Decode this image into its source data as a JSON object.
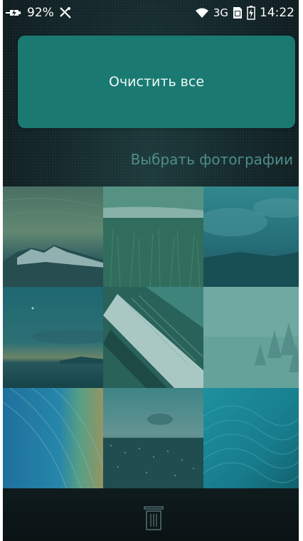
{
  "status_bar": {
    "battery_percent": "92%",
    "network": "3G",
    "time": "14:22",
    "icons": [
      "charging-icon",
      "no-signal-tools-icon",
      "wifi-icon",
      "sim-icon",
      "battery-icon"
    ]
  },
  "clear_all": {
    "label": "Очистить все"
  },
  "select_photos": {
    "label": "Выбрать фотографии"
  },
  "photos": [
    {
      "subject": "snowy mountain",
      "colors": [
        "#6a8376",
        "#3b5a56"
      ]
    },
    {
      "subject": "grass field",
      "colors": [
        "#4d7f6c",
        "#2e5c4e"
      ]
    },
    {
      "subject": "cloudy sky over sea",
      "colors": [
        "#3f7e86",
        "#1f4f5b"
      ]
    },
    {
      "subject": "sea at dusk",
      "colors": [
        "#2f6f78",
        "#183c45"
      ]
    },
    {
      "subject": "snowy coastline aerial",
      "colors": [
        "#4b8d83",
        "#274f48"
      ]
    },
    {
      "subject": "foggy snowy forest",
      "colors": [
        "#6aa39a",
        "#3c7c74"
      ]
    },
    {
      "subject": "abstract blue orange waves",
      "colors": [
        "#2e7fa9",
        "#c0a063"
      ]
    },
    {
      "subject": "city at dusk",
      "colors": [
        "#4c7a7e",
        "#1f3f47"
      ]
    },
    {
      "subject": "abstract teal waves",
      "colors": [
        "#1f8aa4",
        "#0f5670"
      ]
    }
  ],
  "accent_color": "#1a7a72",
  "link_color": "#4f8e89"
}
